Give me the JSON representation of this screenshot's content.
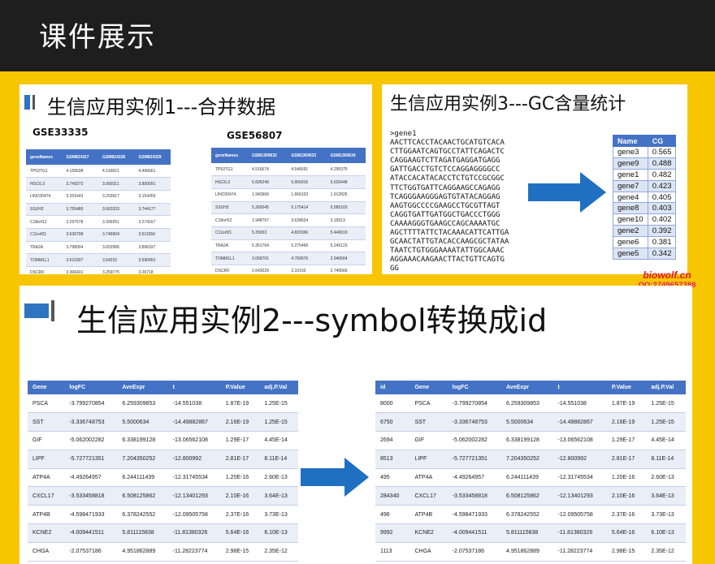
{
  "header": {
    "title": "课件展示"
  },
  "panel1": {
    "title": "生信应用实例1---合并数据",
    "table_left": {
      "name": "GSE33335",
      "columns": [
        "geneNames",
        "GSM824327",
        "GSM824328",
        "GSM824329"
      ],
      "rows": [
        [
          "TP53TG1",
          "4.159038",
          "4.193021",
          "4.466661"
        ],
        [
          "HGC6.3",
          "3.749372",
          "3.900311",
          "3.800091"
        ],
        [
          "LINC00474",
          "3.201643",
          "3.203917",
          "3.154269"
        ],
        [
          "SSUH2",
          "3.755486",
          "3.663333",
          "3.744177"
        ],
        [
          "C18orf12",
          "3.297578",
          "3.399251",
          "3.274167"
        ],
        [
          "C11orf21",
          "3.630708",
          "3.746904",
          "3.511556"
        ],
        [
          "TRA2A",
          "3.798004",
          "3.652986",
          "3.896337"
        ],
        [
          "TOMM1L1",
          "3.610307",
          "3.54215",
          "3.596452"
        ],
        [
          "DSCR9",
          "3.306431",
          "3.259775",
          "3.26718"
        ]
      ]
    },
    "table_right": {
      "name": "GSE56807",
      "columns": [
        "geneNames",
        "GSM1369632",
        "GSM1369633",
        "GSM1369634"
      ],
      "rows": [
        [
          "TP53TG1",
          "4.516674",
          "4.546691",
          "4.295375"
        ],
        [
          "HGC6.3",
          "5.695249",
          "5.956916",
          "5.620448"
        ],
        [
          "LINC00474",
          "1.943969",
          "1.666103",
          "1.912825"
        ],
        [
          "SSUH2",
          "5.260045",
          "5.175414",
          "5.585165"
        ],
        [
          "C18orf12",
          "1.948767",
          "3.638624",
          "3.15013"
        ],
        [
          "C11orf21",
          "5.35653",
          "4.820366",
          "5.449919"
        ],
        [
          "TRA2A",
          "5.351764",
          "5.275469",
          "5.245123"
        ],
        [
          "TOMM1L1",
          "3.099701",
          "4.760676",
          "2.940664"
        ],
        [
          "DSCR9",
          "2.643029",
          "2.10103",
          "2.740566"
        ]
      ]
    }
  },
  "panel2": {
    "title": "生信应用实例3---GC含量统计",
    "fasta": [
      ">gene1",
      "AACTTCACCTACAACTGCATGTCACA",
      "CTTGGAATCAGTGCCTATTCAGACTC",
      "CAGGAAGTCTTAGATGAGGATGAGG",
      "GATTGACCTGTCTCCAGGAGGGGCC",
      "ATACCACATACACCTCTGTCCGCGGC",
      "TTCTGGTGATTCAGGAAGCCAGAGG",
      "TCAGGGAAGGGAGTGTATACAGGAG",
      "AAGTGGCCCCGAAGCCTGCGTTAGT",
      "CAGGTGATTGATGGCTGACCCTGGG",
      "CAAAAGGGTGAAGCCAGCAAAATGC",
      "AGCTTTTATTCTACAAACATTCATTGA",
      "GCAACTATTGTACACCAAGCGCTATAA",
      "TAATCTGTGGGAAAATATTGGCAAAC",
      "AGGAAACAAGAACTTACTGTTCAGTG",
      "GG"
    ],
    "cg_table": {
      "columns": [
        "Name",
        "CG"
      ],
      "rows": [
        [
          "gene3",
          "0.565"
        ],
        [
          "gene9",
          "0.488"
        ],
        [
          "gene1",
          "0.482"
        ],
        [
          "gene7",
          "0.423"
        ],
        [
          "gene4",
          "0.405"
        ],
        [
          "gene8",
          "0.403"
        ],
        [
          "gene10",
          "0.402"
        ],
        [
          "gene2",
          "0.392"
        ],
        [
          "gene6",
          "0.381"
        ],
        [
          "gene5",
          "0.342"
        ]
      ]
    }
  },
  "watermark": {
    "site": "biowolf.cn",
    "qq": "QQ:2749657388"
  },
  "panel3": {
    "title": "生信应用实例2---symbol转换成id",
    "table_left": {
      "columns": [
        "Gene",
        "logFC",
        "AveExpr",
        "t",
        "P.Value",
        "adj.P.Val"
      ],
      "rows": [
        [
          "PSCA",
          "-3.799270854",
          "6.259309853",
          "-14.551038",
          "1.87E-19",
          "1.25E-15"
        ],
        [
          "SST",
          "-3.336748753",
          "5.5000634",
          "-14.49882867",
          "2.16E-19",
          "1.25E-15"
        ],
        [
          "GIF",
          "-5.062002282",
          "6.338199128",
          "-13.06562108",
          "1.29E-17",
          "4.45E-14"
        ],
        [
          "LIPF",
          "-5.727721351",
          "7.204350252",
          "-12.800992",
          "2.81E-17",
          "8.11E-14"
        ],
        [
          "ATP4A",
          "-4.49264957",
          "6.244111439",
          "-12.31745534",
          "1.20E-16",
          "2.60E-13"
        ],
        [
          "CXCL17",
          "-3.533458818",
          "6.508125862",
          "-12.13401293",
          "2.10E-16",
          "3.64E-13"
        ],
        [
          "ATP4B",
          "-4.598471933",
          "6.378242552",
          "-12.09505758",
          "2.37E-16",
          "3.73E-13"
        ],
        [
          "KCNE2",
          "-4.009441511",
          "5.811115838",
          "-11.81380326",
          "5.64E-16",
          "6.10E-13"
        ],
        [
          "CHGA",
          "-2.07537186",
          "4.951862889",
          "-11.28223774",
          "2.98E-15",
          "2.35E-12"
        ]
      ]
    },
    "table_right": {
      "columns": [
        "id",
        "Gene",
        "logFC",
        "AveExpr",
        "t",
        "P.Value",
        "adj.P.Val"
      ],
      "rows": [
        [
          "8000",
          "PSCA",
          "-3.799270854",
          "6.259309853",
          "-14.551038",
          "1.87E-19",
          "1.25E-15"
        ],
        [
          "6750",
          "SST",
          "-3.336748753",
          "5.5000634",
          "-14.49882867",
          "2.16E-19",
          "1.25E-15"
        ],
        [
          "2694",
          "GIF",
          "-5.062002282",
          "6.338199128",
          "-13.06562108",
          "1.29E-17",
          "4.45E-14"
        ],
        [
          "8513",
          "LIPF",
          "-5.727721351",
          "7.204350252",
          "-12.800992",
          "2.81E-17",
          "8.11E-14"
        ],
        [
          "495",
          "ATP4A",
          "-4.49264957",
          "6.244111439",
          "-12.31745534",
          "1.20E-16",
          "2.60E-13"
        ],
        [
          "284340",
          "CXCL17",
          "-3.533458818",
          "6.508125862",
          "-12.13401293",
          "2.10E-16",
          "3.64E-13"
        ],
        [
          "496",
          "ATP4B",
          "-4.598471933",
          "6.378242552",
          "-12.09505758",
          "2.37E-16",
          "3.73E-13"
        ],
        [
          "9992",
          "KCNE2",
          "-4.009441511",
          "5.811115838",
          "-11.81380326",
          "5.64E-16",
          "6.10E-13"
        ],
        [
          "1113",
          "CHGA",
          "-2.07537186",
          "4.951862889",
          "-11.28223774",
          "2.98E-15",
          "2.35E-12"
        ]
      ]
    }
  },
  "colors": {
    "accent_yellow": "#f7c600",
    "header_dark": "#1e1e1e",
    "table_blue": "#4472c4",
    "arrow_blue": "#1f6fc2",
    "watermark_red": "#e8141c"
  }
}
